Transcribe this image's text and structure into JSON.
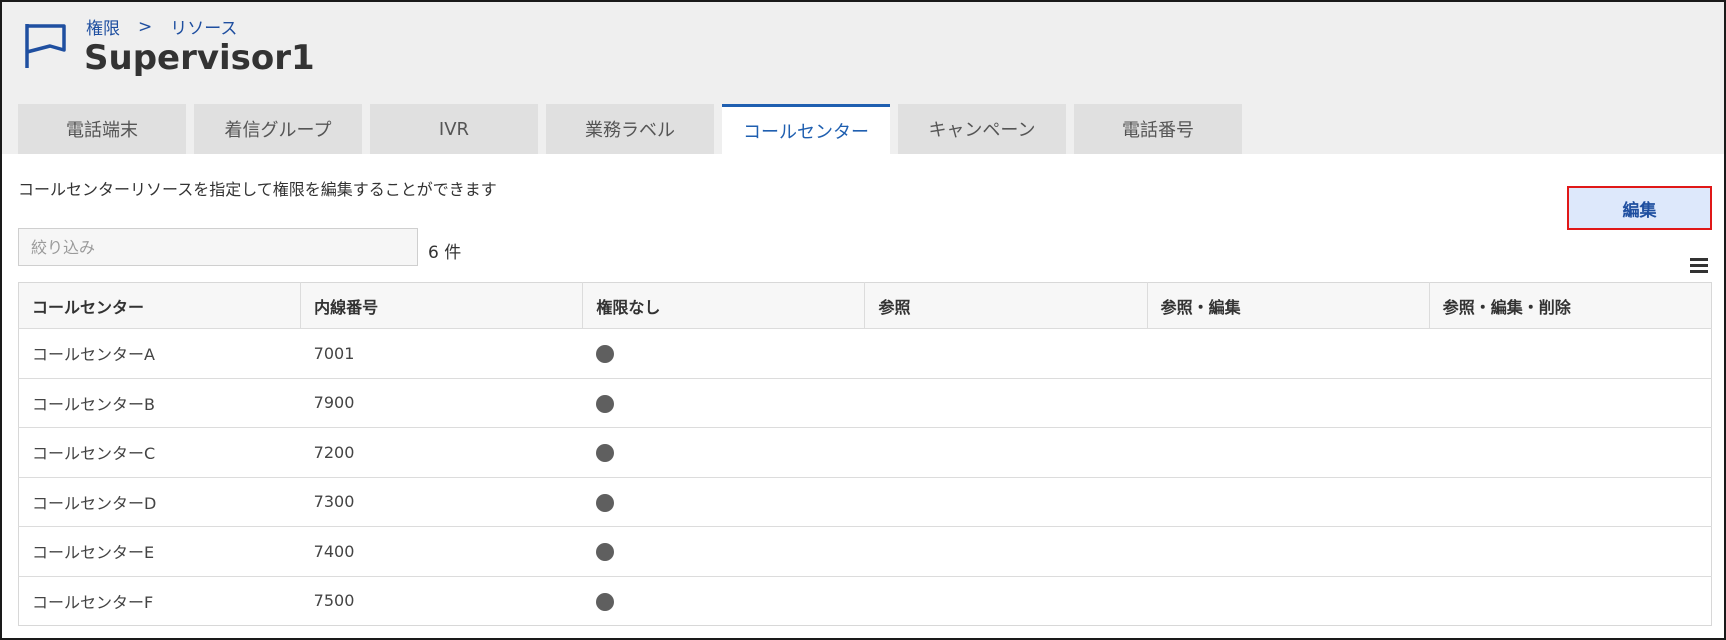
{
  "breadcrumb": {
    "item1": "権限",
    "separator": ">",
    "item2": "リソース"
  },
  "page_title": "Supervisor1",
  "tabs": [
    {
      "label": "電話端末",
      "active": false
    },
    {
      "label": "着信グループ",
      "active": false
    },
    {
      "label": "IVR",
      "active": false
    },
    {
      "label": "業務ラベル",
      "active": false
    },
    {
      "label": "コールセンター",
      "active": true
    },
    {
      "label": "キャンペーン",
      "active": false
    },
    {
      "label": "電話番号",
      "active": false
    }
  ],
  "description": "コールセンターリソースを指定して権限を編集することができます",
  "edit_button": "編集",
  "filter": {
    "placeholder": "絞り込み",
    "value": ""
  },
  "count_label": "6 件",
  "table": {
    "headers": [
      "コールセンター",
      "内線番号",
      "権限なし",
      "参照",
      "参照・編集",
      "参照・編集・削除"
    ],
    "rows": [
      {
        "name": "コールセンターA",
        "ext": "7001",
        "permission": "none"
      },
      {
        "name": "コールセンターB",
        "ext": "7900",
        "permission": "none"
      },
      {
        "name": "コールセンターC",
        "ext": "7200",
        "permission": "none"
      },
      {
        "name": "コールセンターD",
        "ext": "7300",
        "permission": "none"
      },
      {
        "name": "コールセンターE",
        "ext": "7400",
        "permission": "none"
      },
      {
        "name": "コールセンターF",
        "ext": "7500",
        "permission": "none"
      }
    ]
  },
  "colors": {
    "accent": "#1f5fb0",
    "edit_border": "#e01818",
    "edit_bg": "#dde8fb",
    "dot": "#5f5f5f"
  },
  "icons": {
    "page_icon": "flag-icon",
    "menu": "hamburger-menu-icon",
    "radio_selected": "filled-circle-icon"
  }
}
